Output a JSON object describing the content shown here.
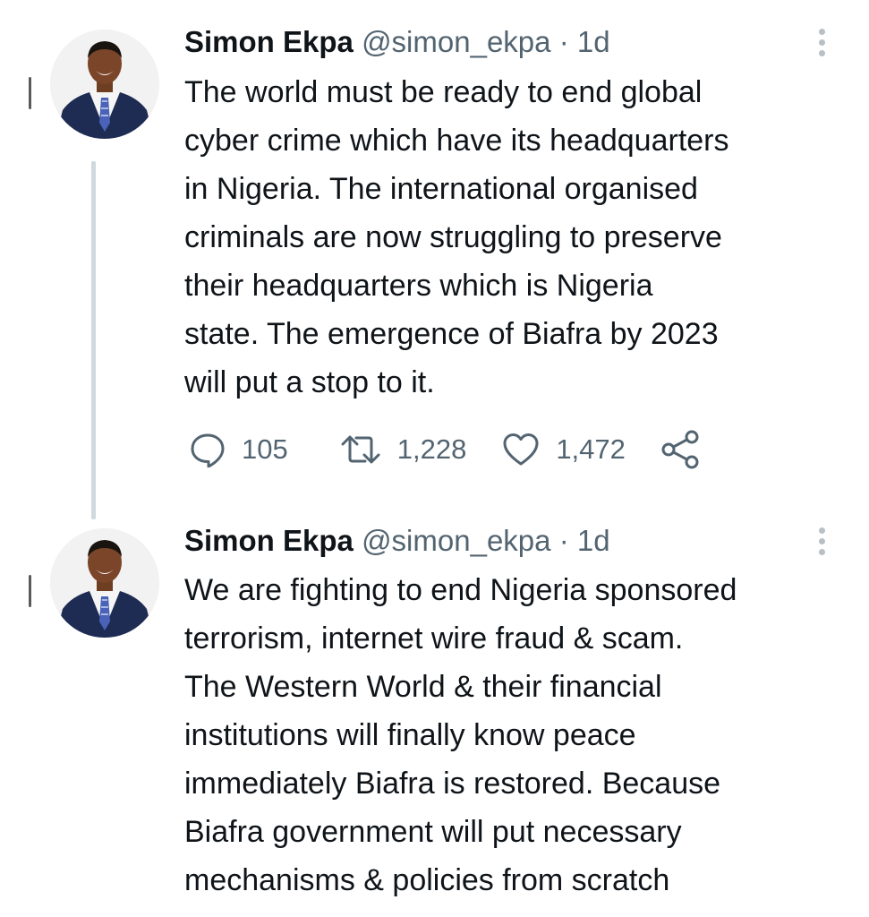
{
  "colors": {
    "text_primary": "#0f1419",
    "text_secondary": "#536471",
    "thread_line": "#cfd9de",
    "more_dots": "#b8c0c6",
    "background": "#ffffff"
  },
  "tweets": [
    {
      "author_name": "Simon Ekpa",
      "handle": "@simon_ekpa",
      "separator": "·",
      "time": "1d",
      "avatar_icon": "profile-photo",
      "more_icon": "vertical-dots-icon",
      "text_lines": [
        "The world must be ready to end global",
        "cyber crime which have its headquarters",
        "in Nigeria. The international organised",
        "criminals are now struggling to preserve",
        "their headquarters which is Nigeria",
        "state. The emergence of Biafra by 2023",
        "will put a stop to it."
      ],
      "actions": {
        "reply_icon": "reply-icon",
        "reply_count": "105",
        "retweet_icon": "retweet-icon",
        "retweet_count": "1,228",
        "like_icon": "heart-icon",
        "like_count": "1,472",
        "share_icon": "share-icon"
      }
    },
    {
      "author_name": "Simon Ekpa",
      "handle": "@simon_ekpa",
      "separator": "·",
      "time": "1d",
      "avatar_icon": "profile-photo",
      "more_icon": "vertical-dots-icon",
      "text_lines": [
        "We are fighting to end Nigeria sponsored",
        "terrorism, internet wire fraud & scam.",
        "The Western World & their financial",
        "institutions will finally know peace",
        "immediately Biafra is restored. Because",
        "Biafra government will put necessary",
        "mechanisms & policies from scratch"
      ]
    }
  ]
}
